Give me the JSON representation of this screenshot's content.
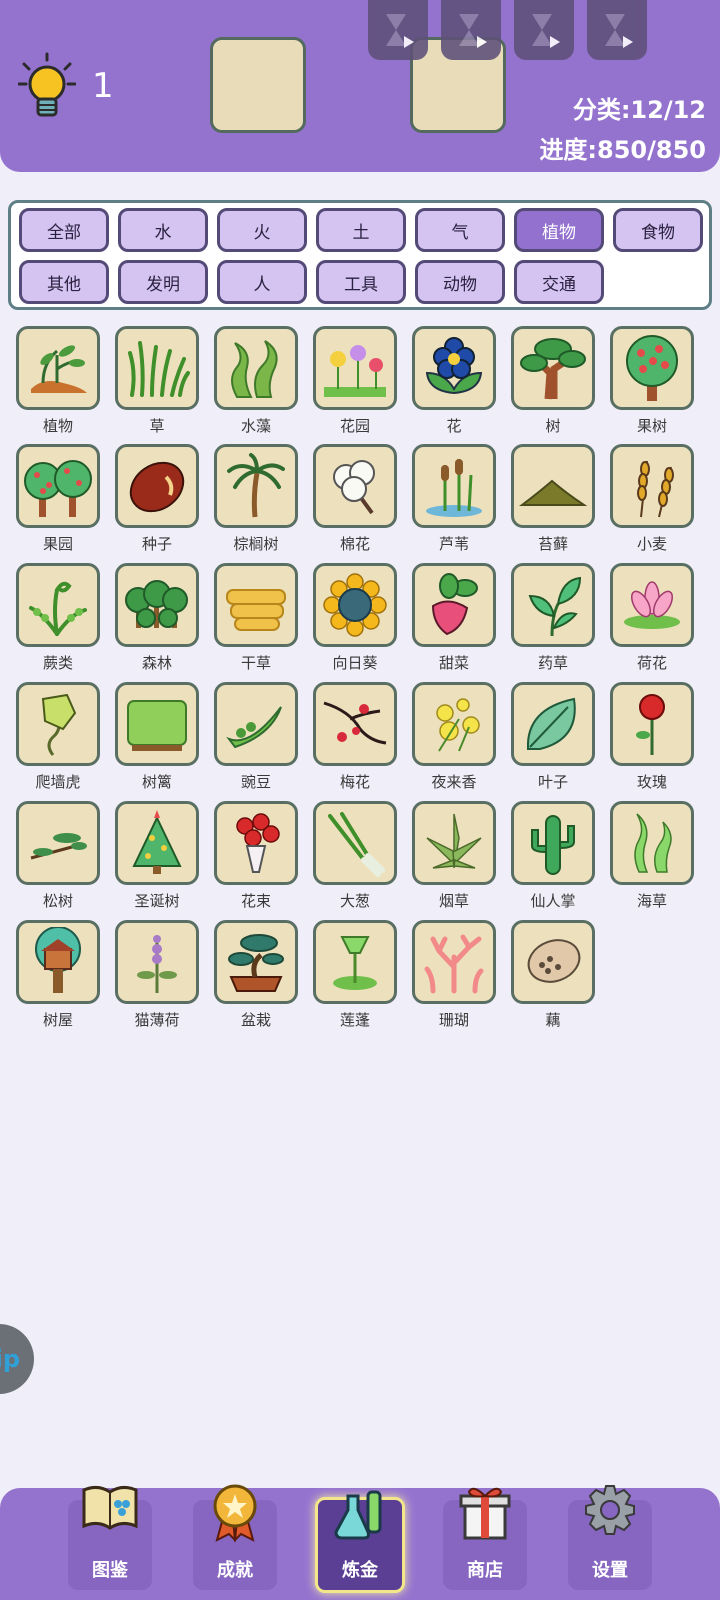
{
  "header": {
    "hint_count": "1",
    "category": "分类:12/12",
    "progress": "进度:850/850"
  },
  "filters": [
    {
      "label": "全部",
      "active": false
    },
    {
      "label": "水",
      "active": false
    },
    {
      "label": "火",
      "active": false
    },
    {
      "label": "土",
      "active": false
    },
    {
      "label": "气",
      "active": false
    },
    {
      "label": "植物",
      "active": true
    },
    {
      "label": "食物",
      "active": false
    },
    {
      "label": "其他",
      "active": false
    },
    {
      "label": "发明",
      "active": false
    },
    {
      "label": "人",
      "active": false
    },
    {
      "label": "工具",
      "active": false
    },
    {
      "label": "动物",
      "active": false
    },
    {
      "label": "交通",
      "active": false
    }
  ],
  "items": [
    {
      "name": "植物",
      "icon": "sprout-icon"
    },
    {
      "name": "草",
      "icon": "grass-icon"
    },
    {
      "name": "水藻",
      "icon": "algae-icon"
    },
    {
      "name": "花园",
      "icon": "garden-icon"
    },
    {
      "name": "花",
      "icon": "flower-icon"
    },
    {
      "name": "树",
      "icon": "tree-icon"
    },
    {
      "name": "果树",
      "icon": "fruit-tree-icon"
    },
    {
      "name": "果园",
      "icon": "orchard-icon"
    },
    {
      "name": "种子",
      "icon": "seed-icon"
    },
    {
      "name": "棕榈树",
      "icon": "palm-tree-icon"
    },
    {
      "name": "棉花",
      "icon": "cotton-icon"
    },
    {
      "name": "芦苇",
      "icon": "reed-icon"
    },
    {
      "name": "苔藓",
      "icon": "moss-icon"
    },
    {
      "name": "小麦",
      "icon": "wheat-icon"
    },
    {
      "name": "蕨类",
      "icon": "fern-icon"
    },
    {
      "name": "森林",
      "icon": "forest-icon"
    },
    {
      "name": "干草",
      "icon": "hay-icon"
    },
    {
      "name": "向日葵",
      "icon": "sunflower-icon"
    },
    {
      "name": "甜菜",
      "icon": "beet-icon"
    },
    {
      "name": "药草",
      "icon": "herb-icon"
    },
    {
      "name": "荷花",
      "icon": "lotus-icon"
    },
    {
      "name": "爬墙虎",
      "icon": "ivy-icon"
    },
    {
      "name": "树篱",
      "icon": "hedge-icon"
    },
    {
      "name": "豌豆",
      "icon": "pea-icon"
    },
    {
      "name": "梅花",
      "icon": "plum-blossom-icon"
    },
    {
      "name": "夜来香",
      "icon": "night-jasmine-icon"
    },
    {
      "name": "叶子",
      "icon": "leaf-icon"
    },
    {
      "name": "玫瑰",
      "icon": "rose-icon"
    },
    {
      "name": "松树",
      "icon": "pine-icon"
    },
    {
      "name": "圣诞树",
      "icon": "christmas-tree-icon"
    },
    {
      "name": "花束",
      "icon": "bouquet-icon"
    },
    {
      "name": "大葱",
      "icon": "scallion-icon"
    },
    {
      "name": "烟草",
      "icon": "tobacco-icon"
    },
    {
      "name": "仙人掌",
      "icon": "cactus-icon"
    },
    {
      "name": "海草",
      "icon": "seaweed-icon"
    },
    {
      "name": "树屋",
      "icon": "treehouse-icon"
    },
    {
      "name": "猫薄荷",
      "icon": "catnip-icon"
    },
    {
      "name": "盆栽",
      "icon": "bonsai-icon"
    },
    {
      "name": "莲蓬",
      "icon": "lotus-pod-icon"
    },
    {
      "name": "珊瑚",
      "icon": "coral-icon"
    },
    {
      "name": "藕",
      "icon": "lotus-root-icon"
    }
  ],
  "help_label": "ip",
  "nav": [
    {
      "label": "图鉴",
      "icon": "book-icon",
      "active": false
    },
    {
      "label": "成就",
      "icon": "medal-icon",
      "active": false
    },
    {
      "label": "炼金",
      "icon": "flask-icon",
      "active": true
    },
    {
      "label": "商店",
      "icon": "gift-icon",
      "active": false
    },
    {
      "label": "设置",
      "icon": "gear-icon",
      "active": false
    }
  ]
}
